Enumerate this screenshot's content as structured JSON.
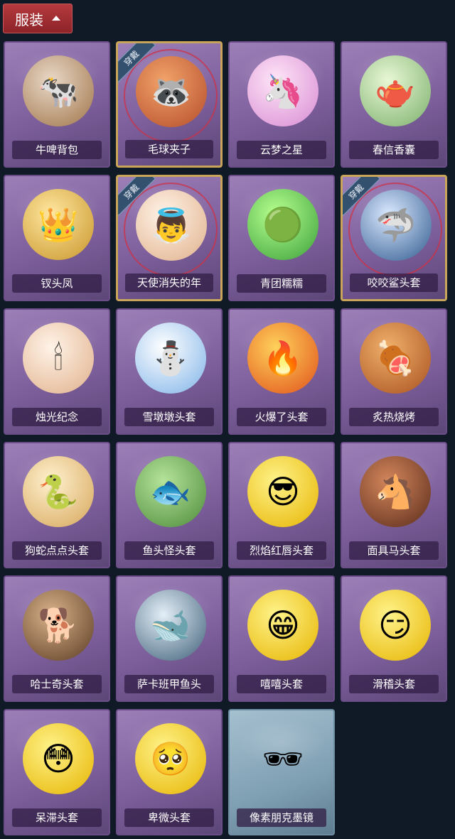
{
  "header": {
    "title": "服装",
    "toggle_icon": "chevron-up-icon"
  },
  "equipped_badge": "穿戴",
  "items": [
    {
      "label": "牛啤背包",
      "icon": "cow-backpack-icon",
      "glyph": "🐄",
      "art": "a-brown",
      "equipped": false,
      "frame": "purple"
    },
    {
      "label": "毛球夹子",
      "icon": "raccoon-clip-icon",
      "glyph": "🦝",
      "art": "a-red",
      "equipped": true,
      "frame": "purple"
    },
    {
      "label": "云梦之星",
      "icon": "unicorn-cloud-icon",
      "glyph": "🦄",
      "art": "a-pink",
      "equipped": false,
      "frame": "purple"
    },
    {
      "label": "春信香囊",
      "icon": "sachet-icon",
      "glyph": "🫖",
      "art": "a-green",
      "equipped": false,
      "frame": "purple"
    },
    {
      "label": "钗头凤",
      "icon": "phoenix-crown-icon",
      "glyph": "👑",
      "art": "a-gold",
      "equipped": false,
      "frame": "purple"
    },
    {
      "label": "天使消失的年",
      "icon": "angel-doll-icon",
      "glyph": "👼",
      "art": "a-cream",
      "equipped": true,
      "frame": "purple"
    },
    {
      "label": "青团糯糯",
      "icon": "green-rice-ball-icon",
      "glyph": "🟢",
      "art": "a-lime",
      "equipped": false,
      "frame": "purple"
    },
    {
      "label": "咬咬鲨头套",
      "icon": "shark-head-icon",
      "glyph": "🦈",
      "art": "a-shark",
      "equipped": true,
      "frame": "purple"
    },
    {
      "label": "烛光纪念",
      "icon": "candle-icon",
      "glyph": "🕯",
      "art": "a-cream",
      "equipped": false,
      "frame": "purple"
    },
    {
      "label": "雪墩墩头套",
      "icon": "snowman-head-icon",
      "glyph": "⛄",
      "art": "a-snow",
      "equipped": false,
      "frame": "purple"
    },
    {
      "label": "火爆了头套",
      "icon": "fire-head-icon",
      "glyph": "🔥",
      "art": "a-fire",
      "equipped": false,
      "frame": "purple"
    },
    {
      "label": "炙热烧烤",
      "icon": "meat-head-icon",
      "glyph": "🍖",
      "art": "a-meat",
      "equipped": false,
      "frame": "purple"
    },
    {
      "label": "狗蛇点点头套",
      "icon": "dog-snake-head-icon",
      "glyph": "🐍",
      "art": "a-tan",
      "equipped": false,
      "frame": "purple"
    },
    {
      "label": "鱼头怪头套",
      "icon": "fish-head-icon",
      "glyph": "🐟",
      "art": "a-fish",
      "equipped": false,
      "frame": "purple"
    },
    {
      "label": "烈焰红唇头套",
      "icon": "pikachu-head-icon",
      "glyph": "😎",
      "art": "a-yellow",
      "equipped": false,
      "frame": "purple"
    },
    {
      "label": "面具马头套",
      "icon": "horse-mask-icon",
      "glyph": "🐴",
      "art": "a-horse",
      "equipped": false,
      "frame": "purple"
    },
    {
      "label": "哈士奇头套",
      "icon": "husky-head-icon",
      "glyph": "🐕",
      "art": "a-dog",
      "equipped": false,
      "frame": "purple"
    },
    {
      "label": "萨卡班甲鱼头",
      "icon": "sacabambaspis-head-icon",
      "glyph": "🐋",
      "art": "a-gray",
      "equipped": false,
      "frame": "purple"
    },
    {
      "label": "嘻嘻头套",
      "icon": "grin-face-icon",
      "glyph": "😁",
      "art": "a-yellow",
      "equipped": false,
      "frame": "purple"
    },
    {
      "label": "滑稽头套",
      "icon": "funny-face-icon",
      "glyph": "😏",
      "art": "a-yellow",
      "equipped": false,
      "frame": "purple"
    },
    {
      "label": "呆滞头套",
      "icon": "dazed-face-icon",
      "glyph": "😳",
      "art": "a-yellow",
      "equipped": false,
      "frame": "purple"
    },
    {
      "label": "卑微头套",
      "icon": "humble-face-icon",
      "glyph": "🥺",
      "art": "a-yellow",
      "equipped": false,
      "frame": "purple"
    },
    {
      "label": "像素朋克墨镜",
      "icon": "pixel-sunglasses-icon",
      "glyph": "🕶",
      "art": "a-glass",
      "equipped": false,
      "frame": "blue"
    }
  ]
}
